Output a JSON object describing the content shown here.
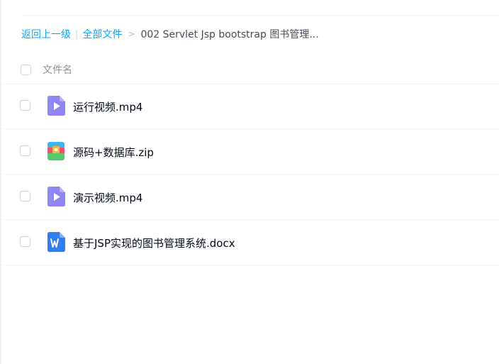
{
  "breadcrumb": {
    "back_label": "返回上一级",
    "separator": "|",
    "root_label": "全部文件",
    "arrow": ">",
    "current_label": "002 Servlet Jsp bootstrap 图书管理..."
  },
  "list_header": {
    "name_label": "文件名"
  },
  "files": [
    {
      "name": "运行视频.mp4",
      "icon": "video-file-icon"
    },
    {
      "name": "源码+数据库.zip",
      "icon": "zip-archive-icon"
    },
    {
      "name": "演示视频.mp4",
      "icon": "video-file-icon"
    },
    {
      "name": "基于JSP实现的图书管理系统.docx",
      "icon": "word-document-icon"
    }
  ],
  "colors": {
    "link": "#06a7ff",
    "video_icon": "#8f86f5",
    "word_icon": "#2f7ff3"
  }
}
